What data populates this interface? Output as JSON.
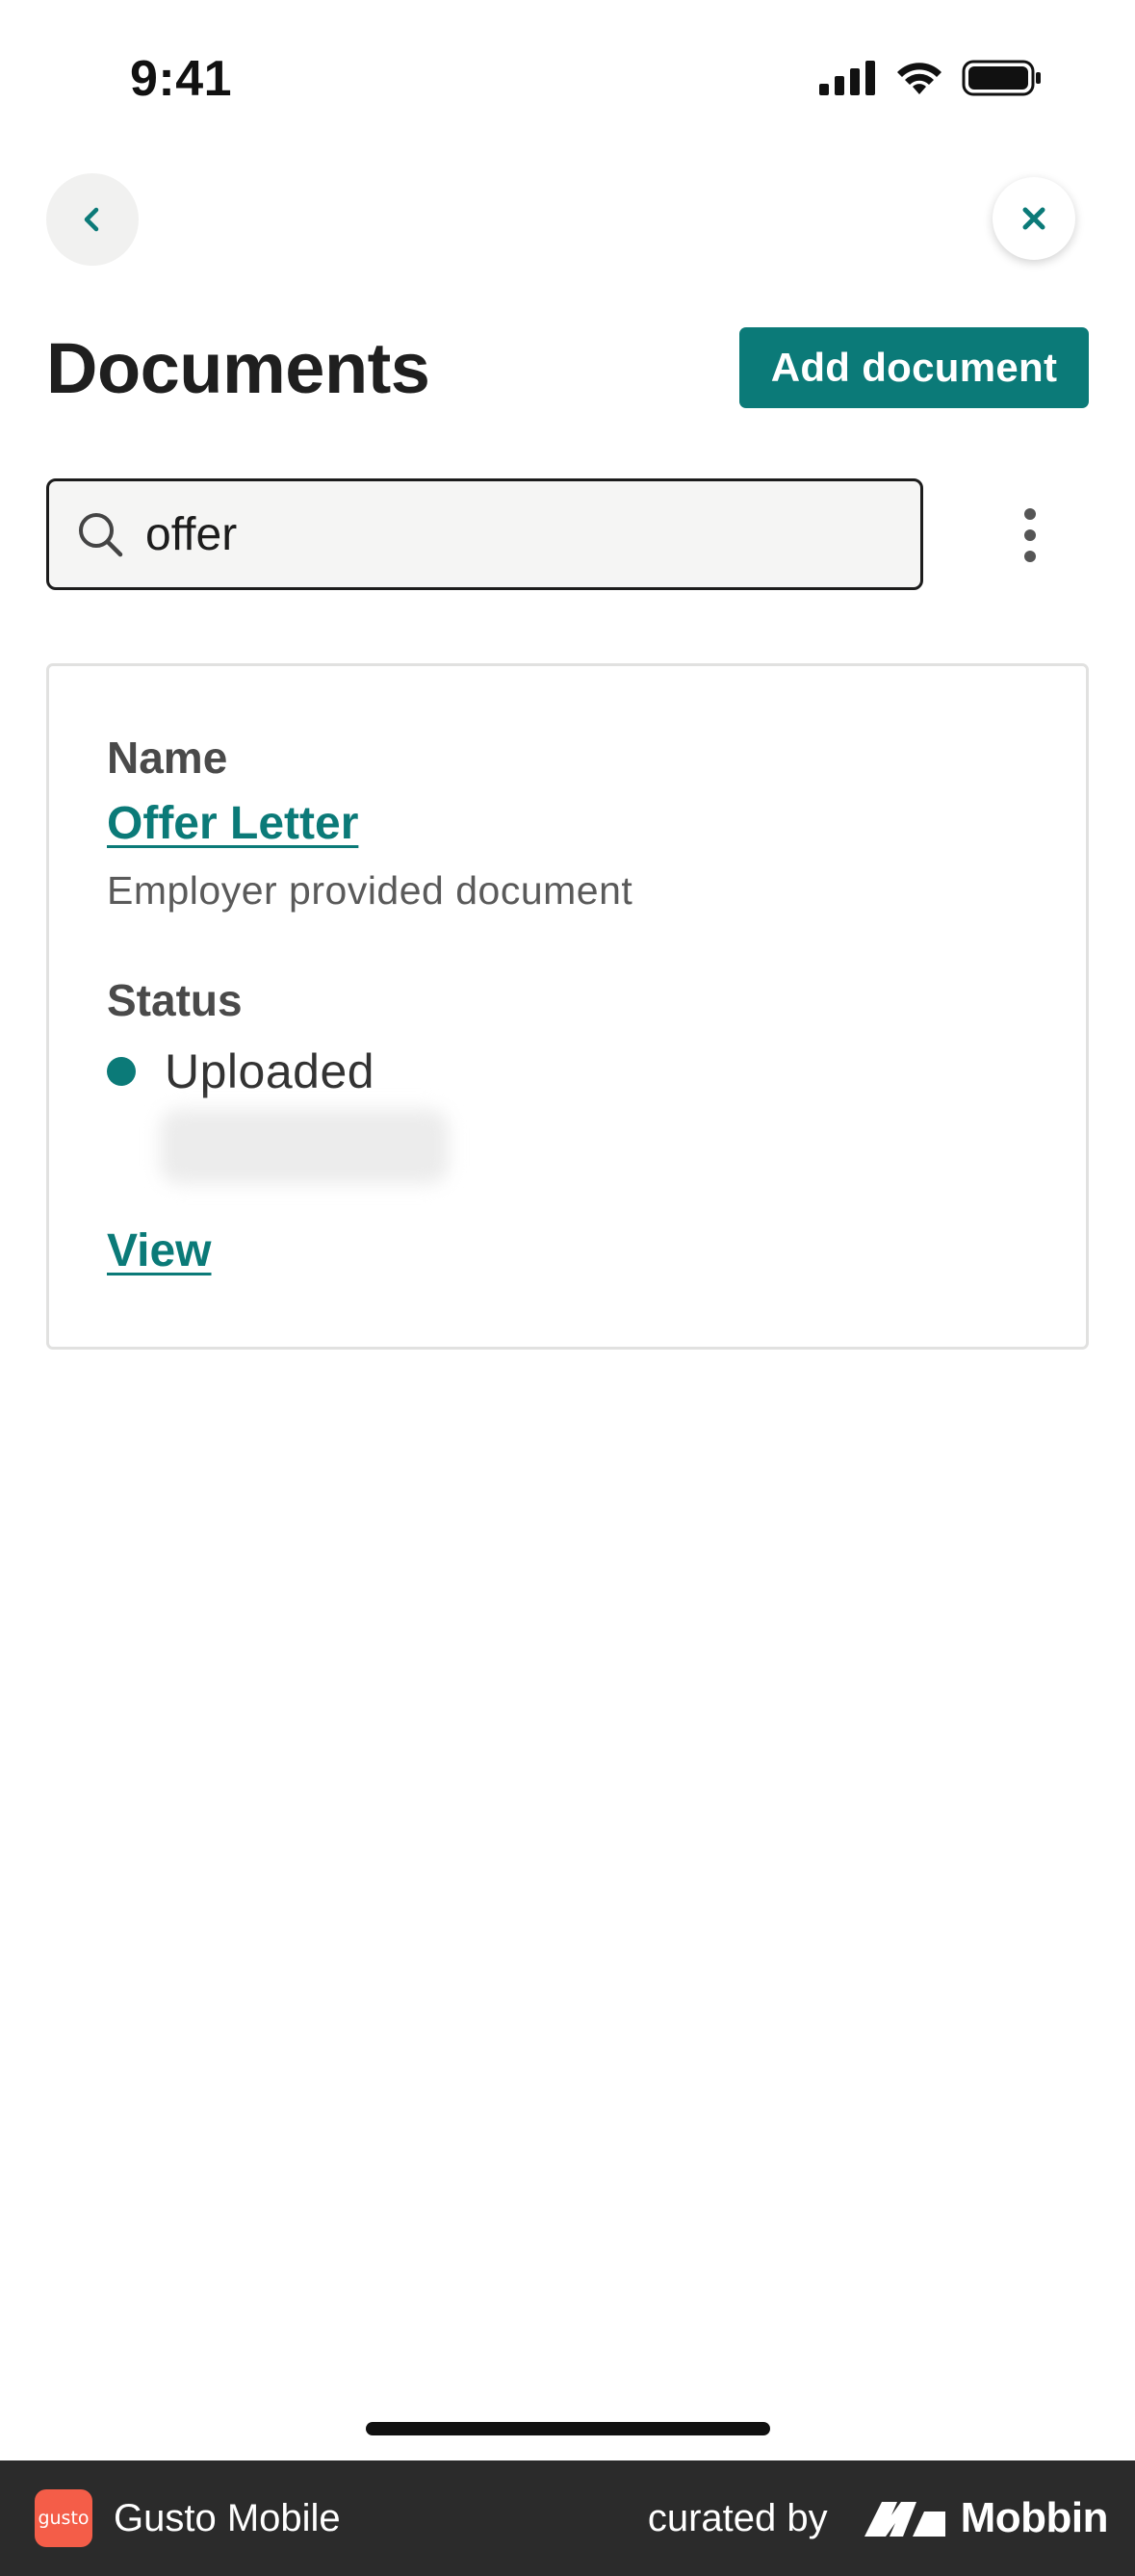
{
  "status_bar": {
    "time": "9:41"
  },
  "header": {
    "title": "Documents",
    "add_button_label": "Add document"
  },
  "search": {
    "value": "offer",
    "placeholder": ""
  },
  "document_card": {
    "name_label": "Name",
    "name_value": "Offer Letter",
    "source": "Employer provided document",
    "status_label": "Status",
    "status_value": "Uploaded",
    "view_label": "View"
  },
  "footer": {
    "logo_text": "gusto",
    "app_name": "Gusto Mobile",
    "curated_by": "curated by",
    "brand": "Mobbin"
  },
  "colors": {
    "accent": "#0b7a78",
    "footer_bg": "#2b2b2b",
    "logo_bg": "#f45d48"
  },
  "icons": [
    "back-chevron-icon",
    "close-icon",
    "search-icon",
    "more-vertical-icon",
    "signal-icon",
    "wifi-icon",
    "battery-icon"
  ]
}
